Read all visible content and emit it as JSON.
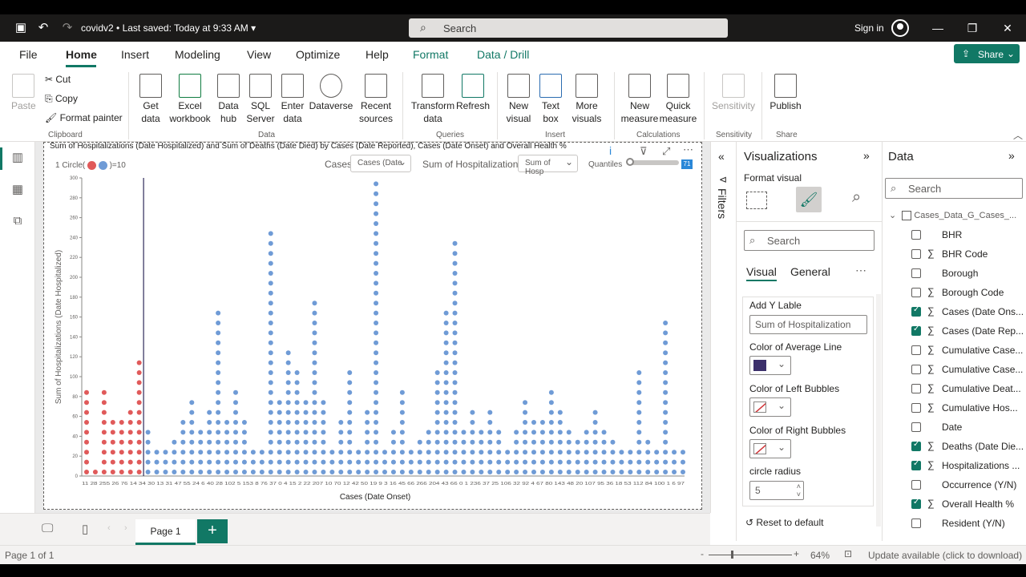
{
  "window": {
    "file_name": "covidv2",
    "saved_status": "Last saved: Today at 9:33 AM",
    "search_placeholder": "Search",
    "sign_in": "Sign in"
  },
  "menu": {
    "tabs": [
      "File",
      "Home",
      "Insert",
      "Modeling",
      "View",
      "Optimize",
      "Help",
      "Format",
      "Data / Drill"
    ],
    "active": "Home",
    "share": "Share"
  },
  "ribbon": {
    "clipboard": {
      "paste": "Paste",
      "cut": "Cut",
      "copy": "Copy",
      "format_painter": "Format painter",
      "group": "Clipboard"
    },
    "data": {
      "get_data": "Get data",
      "excel": "Excel workbook",
      "data_hub": "Data hub",
      "sql": "SQL Server",
      "enter_data": "Enter data",
      "dataverse": "Dataverse",
      "recent": "Recent sources",
      "group": "Data"
    },
    "queries": {
      "transform": "Transform data",
      "refresh": "Refresh",
      "group": "Queries"
    },
    "insert": {
      "new_visual": "New visual",
      "text_box": "Text box",
      "more_visuals": "More visuals",
      "group": "Insert"
    },
    "calculations": {
      "new_measure": "New measure",
      "quick_measure": "Quick measure",
      "group": "Calculations"
    },
    "sensitivity": {
      "label": "Sensitivity",
      "group": "Sensitivity"
    },
    "share": {
      "publish": "Publish",
      "group": "Share"
    }
  },
  "visual": {
    "title": "Sum of Hospitalizations (Date Hospitalized) and Sum of Deaths (Date Died) by Cases (Date Reported), Cases (Date Onset) and Overall Health %",
    "legend": "1 Circle(",
    "legend_suffix": ")=10",
    "cases_label": "Cases",
    "cases_select": "Cases (Date",
    "hosp_label": "Sum of Hospitalization",
    "hosp_select": "Sum of Hosp",
    "quantiles_label": "Quantiles",
    "quantiles_value": "71"
  },
  "chart_data": {
    "type": "scatter",
    "title": "",
    "xlabel": "Cases (Date Onset)",
    "ylabel": "Sum of Hospitalizations (Date Hospitalized)",
    "ylim": [
      0,
      300
    ],
    "yticks": [
      0,
      20,
      40,
      60,
      80,
      100,
      120,
      140,
      160,
      180,
      200,
      220,
      240,
      260,
      280,
      300
    ],
    "categories": [
      "11",
      "28",
      "255",
      "26",
      "76",
      "14",
      "34",
      "30",
      "13",
      "31",
      "47",
      "55",
      "24",
      "6",
      "40",
      "28",
      "102",
      "5",
      "153",
      "8",
      "76",
      "37",
      "0",
      "4",
      "15",
      "2",
      "22",
      "207",
      "10",
      "70",
      "12",
      "42",
      "50",
      "19",
      "9",
      "3",
      "16",
      "45",
      "66",
      "266",
      "204",
      "43",
      "66",
      "0",
      "1",
      "236",
      "37",
      "25",
      "106",
      "32",
      "92",
      "4",
      "67",
      "80",
      "143",
      "48",
      "20",
      "107",
      "95",
      "36",
      "18",
      "53",
      "112",
      "84",
      "100",
      "1",
      "6",
      "97"
    ],
    "x_tick_text": "11 28 255 26 76 14 34 30 13 31 47 55 24 6 40 28 102 5 153 8 76 37 0 4 15 2 22 207 10 70 12 42 50 19 9 3 16 45 66 266 204 43 66 0 1 236 37 25 106 32 92 4 67 80 143 48 20 107 95 36 18 53 112 84 100 1 6 97",
    "series": [
      {
        "name": "Left Bubbles",
        "color": "#e05a5a",
        "values": [
          80,
          0,
          80,
          50,
          50,
          60,
          110
        ]
      },
      {
        "name": "Right Bubbles",
        "color": "#6f9bd6",
        "values": [
          40,
          20,
          20,
          30,
          50,
          70,
          40,
          60,
          160,
          50,
          80,
          50,
          20,
          20,
          240,
          70,
          120,
          100,
          70,
          170,
          70,
          20,
          50,
          100,
          20,
          60,
          290,
          20,
          40,
          80,
          20,
          30,
          40,
          100,
          160,
          230,
          40,
          60,
          40,
          60,
          40,
          20,
          40,
          70,
          50,
          50,
          80,
          60,
          40,
          30,
          40,
          60,
          40,
          30,
          20,
          20,
          100,
          30,
          20,
          150,
          20,
          20
        ]
      }
    ],
    "average_line_after_index": 7,
    "average_line_color": "#2f2a5a"
  },
  "filters": {
    "label": "Filters"
  },
  "visualizations": {
    "title": "Visualizations",
    "format_visual": "Format visual",
    "search": "Search",
    "tab_visual": "Visual",
    "tab_general": "General",
    "add_y_label": "Add Y Lable",
    "y_label_value": "Sum of Hospitalization",
    "avg_line_label": "Color of Average Line",
    "avg_line_color": "#3b2f6b",
    "left_bubbles_label": "Color of Left Bubbles",
    "right_bubbles_label": "Color of Right Bubbles",
    "radius_label": "circle radius",
    "radius_value": "5",
    "reset": "Reset to default"
  },
  "data_pane": {
    "title": "Data",
    "search": "Search",
    "table": "Cases_Data_G_Cases_...",
    "fields": [
      {
        "label": "BHR",
        "sigma": false,
        "checked": false
      },
      {
        "label": "BHR Code",
        "sigma": true,
        "checked": false
      },
      {
        "label": "Borough",
        "sigma": false,
        "checked": false
      },
      {
        "label": "Borough Code",
        "sigma": true,
        "checked": false
      },
      {
        "label": "Cases (Date Ons...",
        "sigma": true,
        "checked": true
      },
      {
        "label": "Cases (Date Rep...",
        "sigma": true,
        "checked": true
      },
      {
        "label": "Cumulative Case...",
        "sigma": true,
        "checked": false
      },
      {
        "label": "Cumulative Case...",
        "sigma": true,
        "checked": false
      },
      {
        "label": "Cumulative Deat...",
        "sigma": true,
        "checked": false
      },
      {
        "label": "Cumulative Hos...",
        "sigma": true,
        "checked": false
      },
      {
        "label": "Date",
        "sigma": false,
        "checked": false
      },
      {
        "label": "Deaths (Date Die...",
        "sigma": true,
        "checked": true
      },
      {
        "label": "Hospitalizations ...",
        "sigma": true,
        "checked": true
      },
      {
        "label": "Occurrence (Y/N)",
        "sigma": false,
        "checked": false
      },
      {
        "label": "Overall Health %",
        "sigma": true,
        "checked": true
      },
      {
        "label": "Resident (Y/N)",
        "sigma": false,
        "checked": false
      }
    ]
  },
  "pages": {
    "current": "Page 1",
    "add": "+"
  },
  "status": {
    "page_info": "Page 1 of 1",
    "zoom": "64%",
    "update": "Update available (click to download)"
  }
}
